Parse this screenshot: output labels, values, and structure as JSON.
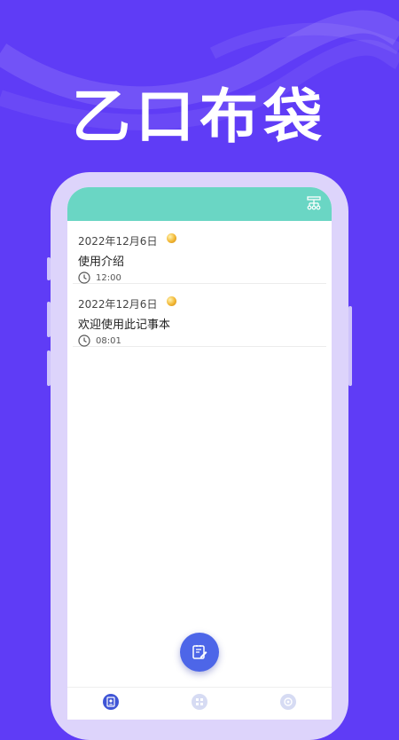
{
  "hero": {
    "title": "乙口布袋"
  },
  "colors": {
    "background": "#5f3cf6",
    "phone_frame": "#ddd4fb",
    "header": "#6ad6c4",
    "fab": "#4d66e8",
    "nav_active": "#3f55d6",
    "nav_inactive": "#d6dbf3"
  },
  "header": {
    "icon": "sitemap-icon"
  },
  "notes": [
    {
      "date": "2022年12月6日",
      "mood_icon": "emoji-icon",
      "title": "使用介绍",
      "time_icon": "clock-icon",
      "time": "12:00"
    },
    {
      "date": "2022年12月6日",
      "mood_icon": "emoji-icon",
      "title": "欢迎使用此记事本",
      "time_icon": "clock-icon",
      "time": "08:01"
    }
  ],
  "fab": {
    "icon": "edit-note-icon"
  },
  "bottom_nav": [
    {
      "icon": "contact-icon",
      "active": true
    },
    {
      "icon": "grid-icon",
      "active": false
    },
    {
      "icon": "settings-icon",
      "active": false
    }
  ]
}
